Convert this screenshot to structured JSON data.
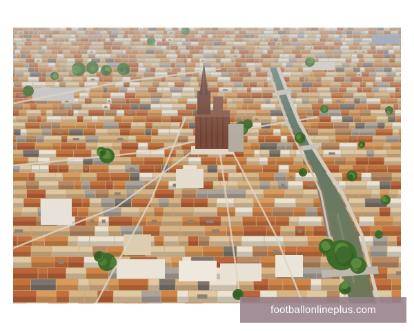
{
  "watermark": {
    "text": "footballonlineplus.com"
  },
  "colors": {
    "page_background": "#ffffff",
    "watermark_background": "#96808a",
    "watermark_text": "#ffffff"
  }
}
